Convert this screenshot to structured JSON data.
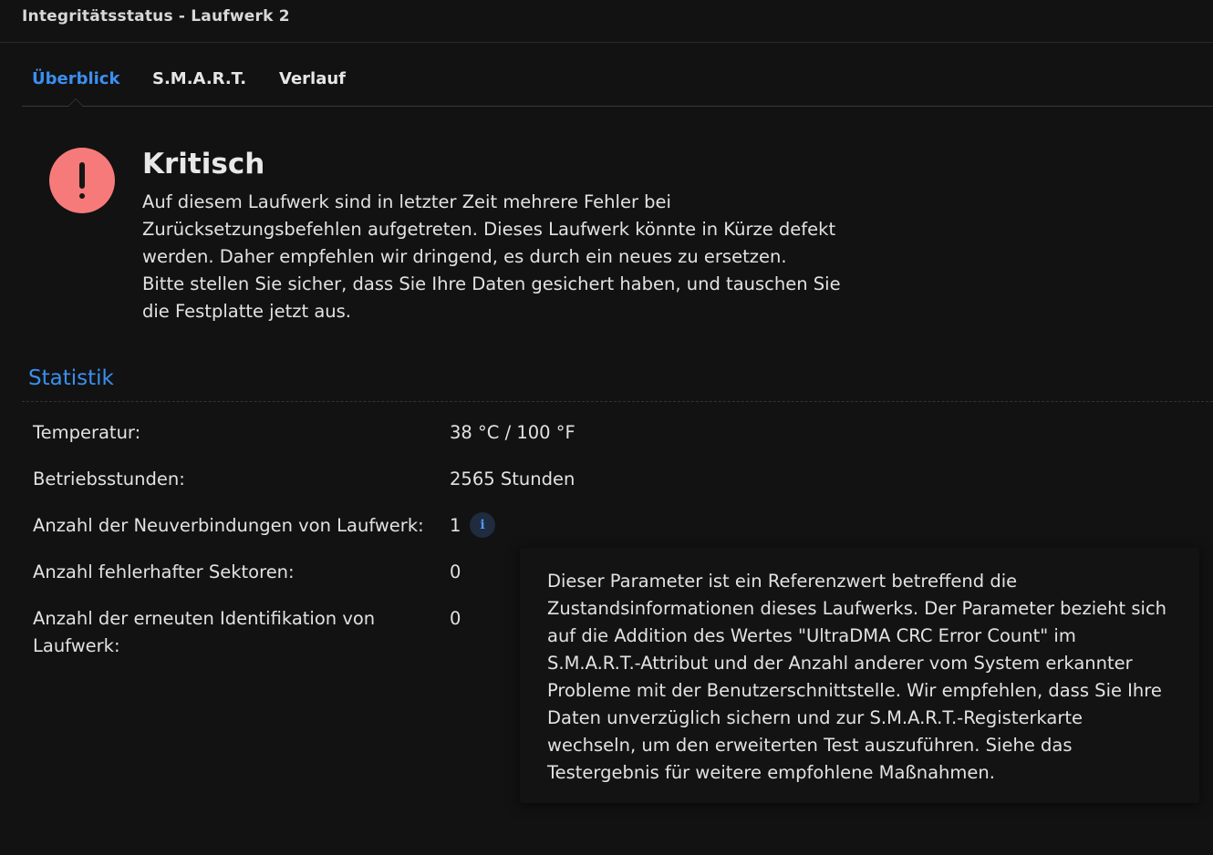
{
  "window": {
    "title": "Integritätsstatus - Laufwerk 2"
  },
  "tabs": [
    {
      "label": "Überblick",
      "active": true
    },
    {
      "label": "S.M.A.R.T.",
      "active": false
    },
    {
      "label": "Verlauf",
      "active": false
    }
  ],
  "status": {
    "icon": "exclamation-alert-icon",
    "color": "#f77a7a",
    "heading": "Kritisch",
    "description_lines": [
      "Auf diesem Laufwerk sind in letzter Zeit mehrere Fehler bei",
      "Zurücksetzungsbefehlen aufgetreten. Dieses Laufwerk könnte in Kürze defekt",
      "werden. Daher empfehlen wir dringend, es durch ein neues zu ersetzen.",
      "Bitte stellen Sie sicher, dass Sie Ihre Daten gesichert haben, und tauschen Sie",
      "die Festplatte jetzt aus."
    ]
  },
  "statistics": {
    "title": "Statistik",
    "accent_color": "#3b8ff0",
    "rows": [
      {
        "label": "Temperatur:",
        "value": "38 °C / 100 °F"
      },
      {
        "label": "Betriebsstunden:",
        "value": "2565 Stunden"
      },
      {
        "label": "Anzahl der Neuverbindungen von Laufwerk:",
        "value": "1",
        "info_icon": "info-icon"
      },
      {
        "label": "Anzahl fehlerhafter Sektoren:",
        "value": "0"
      },
      {
        "label_lines": [
          "Anzahl der erneuten Identifikation von",
          "Laufwerk:"
        ],
        "value": "0"
      }
    ]
  },
  "tooltip": {
    "lines": [
      "Dieser Parameter ist ein Referenzwert betreffend die",
      "Zustandsinformationen dieses Laufwerks. Der Parameter bezieht sich",
      "auf die Addition des Wertes \"UltraDMA CRC Error Count\" im",
      "S.M.A.R.T.-Attribut und der Anzahl anderer vom System erkannter",
      "Probleme mit der Benutzerschnittstelle. Wir empfehlen, dass Sie Ihre",
      "Daten unverzüglich sichern und zur S.M.A.R.T.-Registerkarte",
      "wechseln, um den erweiterten Test auszuführen. Siehe das",
      "Testergebnis für weitere empfohlene Maßnahmen."
    ]
  }
}
